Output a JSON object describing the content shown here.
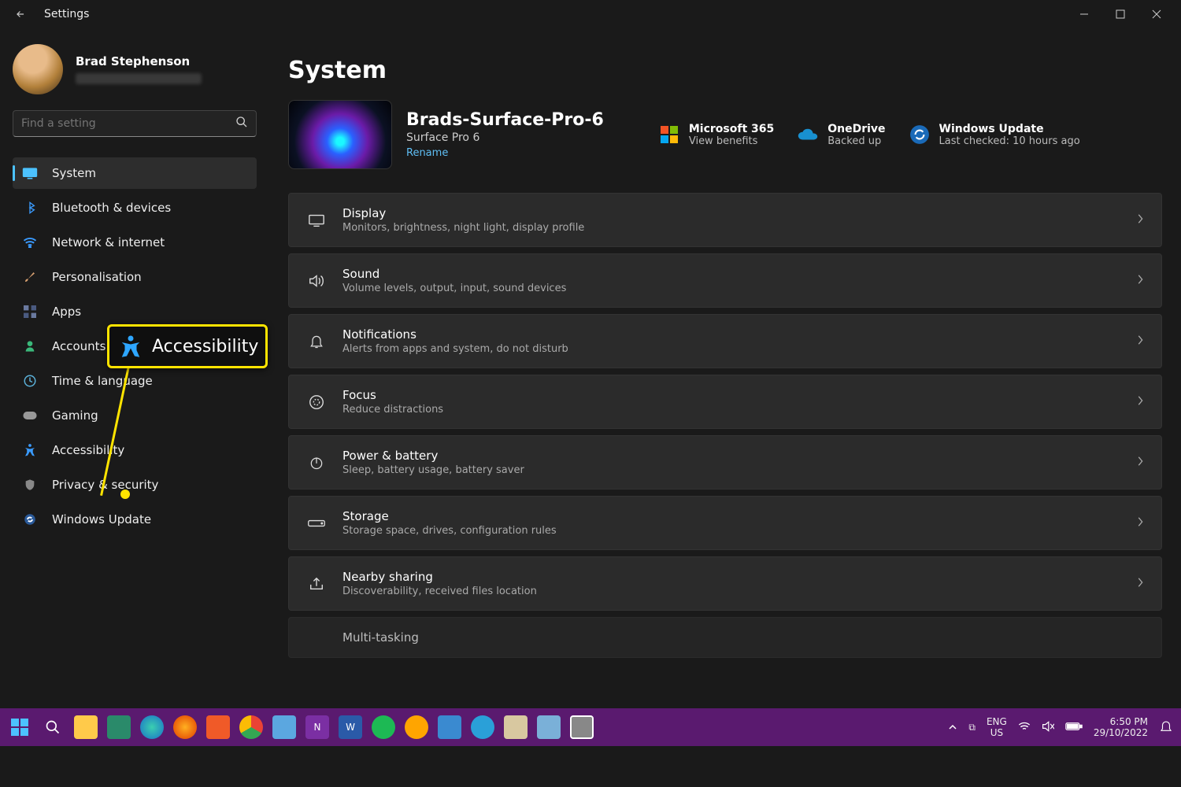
{
  "window": {
    "title": "Settings"
  },
  "user": {
    "name": "Brad Stephenson"
  },
  "search": {
    "placeholder": "Find a setting"
  },
  "nav": {
    "items": [
      {
        "label": "System"
      },
      {
        "label": "Bluetooth & devices"
      },
      {
        "label": "Network & internet"
      },
      {
        "label": "Personalisation"
      },
      {
        "label": "Apps"
      },
      {
        "label": "Accounts"
      },
      {
        "label": "Time & language"
      },
      {
        "label": "Gaming"
      },
      {
        "label": "Accessibility"
      },
      {
        "label": "Privacy & security"
      },
      {
        "label": "Windows Update"
      }
    ]
  },
  "main": {
    "title": "System",
    "device": {
      "name": "Brads-Surface-Pro-6",
      "model": "Surface Pro 6",
      "rename": "Rename"
    },
    "m365": {
      "title": "Microsoft 365",
      "sub": "View benefits"
    },
    "onedrive": {
      "title": "OneDrive",
      "sub": "Backed up"
    },
    "winupd": {
      "title": "Windows Update",
      "sub": "Last checked: 10 hours ago"
    },
    "rows": [
      {
        "title": "Display",
        "sub": "Monitors, brightness, night light, display profile"
      },
      {
        "title": "Sound",
        "sub": "Volume levels, output, input, sound devices"
      },
      {
        "title": "Notifications",
        "sub": "Alerts from apps and system, do not disturb"
      },
      {
        "title": "Focus",
        "sub": "Reduce distractions"
      },
      {
        "title": "Power & battery",
        "sub": "Sleep, battery usage, battery saver"
      },
      {
        "title": "Storage",
        "sub": "Storage space, drives, configuration rules"
      },
      {
        "title": "Nearby sharing",
        "sub": "Discoverability, received files location"
      },
      {
        "title": "Multi-tasking",
        "sub": ""
      }
    ]
  },
  "callout": {
    "label": "Accessibility"
  },
  "taskbar": {
    "lang1": "ENG",
    "lang2": "US",
    "time": "6:50 PM",
    "date": "29/10/2022"
  }
}
